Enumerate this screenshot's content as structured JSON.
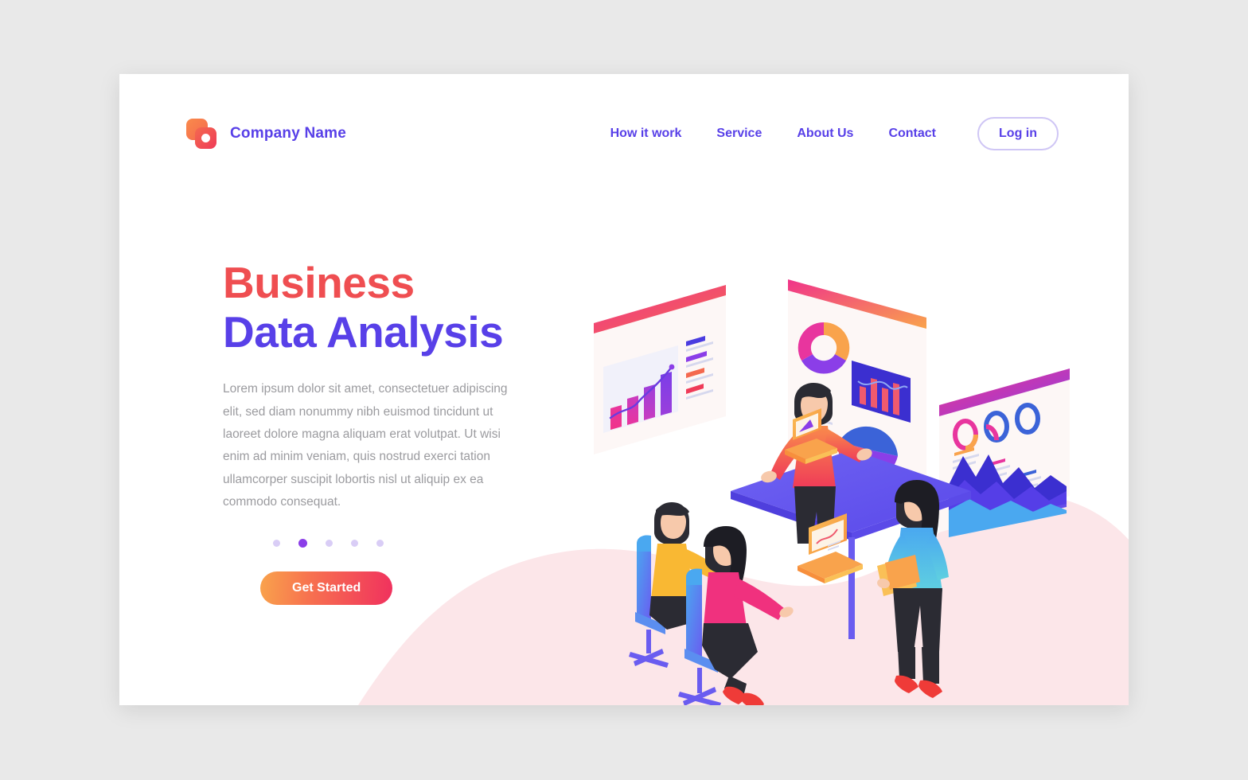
{
  "background_color": "#e9e9e9",
  "card_color": "#ffffff",
  "colors": {
    "primary_purple": "#5840e8",
    "accent_red": "#ef4e51",
    "accent_orange": "#f9a34c",
    "accent_pink": "#f0315e",
    "blob_pink": "#fce6e9",
    "muted_text": "#9b9b9f",
    "dot_inactive": "#d9cdf6",
    "dot_active": "#8b3ee8",
    "login_border": "#cfc6f5"
  },
  "header": {
    "brand_name": "Company Name",
    "logo_icon": "overlapping-squares-icon",
    "nav_items": [
      {
        "label": "How it work",
        "name": "nav-link-how-it-work"
      },
      {
        "label": "Service",
        "name": "nav-link-service"
      },
      {
        "label": "About Us",
        "name": "nav-link-about-us"
      },
      {
        "label": "Contact",
        "name": "nav-link-contact"
      }
    ],
    "login_label": "Log in"
  },
  "hero": {
    "title_line_1": "Business",
    "title_line_2": "Data Analysis",
    "paragraph": "Lorem ipsum dolor sit amet, consectetuer adipiscing elit, sed diam nonummy nibh euismod tincidunt ut laoreet dolore magna aliquam erat volutpat. Ut wisi enim ad minim veniam, quis nostrud exerci tation ullamcorper suscipit lobortis nisl ut aliquip ex ea commodo consequat.",
    "cta_label": "Get Started",
    "carousel": {
      "total_dots": 5,
      "active_index": 1
    }
  },
  "illustration": {
    "name": "isometric-business-data-analysis-illustration",
    "description": "Isometric scene: a presenter standing in front of three floating dashboard screens, two colleagues seated at a purple desk with laptops, and a standing woman holding a folder.",
    "screens": [
      {
        "name": "screen-left-bar-chart",
        "header_gradient": [
          "#f0338a",
          "#f4694f"
        ],
        "widgets": [
          "bar-chart",
          "trend-line",
          "list-rows"
        ],
        "bar_values": [
          38,
          55,
          72,
          92
        ],
        "bar_colors": [
          "#e8359e",
          "#d637a8",
          "#a93fd0",
          "#8b3ee8"
        ],
        "list_row_colors": [
          "#5840e8",
          "#8b3ee8",
          "#f4694f",
          "#ef3b58"
        ]
      },
      {
        "name": "screen-center-mixed",
        "header_gradient": [
          "#f0338a",
          "#f9a34c"
        ],
        "widgets": [
          "donut-chart",
          "list-rows",
          "bar-panel",
          "pie-chart"
        ],
        "donut_segments": [
          {
            "color": "#f9a34c",
            "pct": 34
          },
          {
            "color": "#8b3ee8",
            "pct": 33
          },
          {
            "color": "#e8359e",
            "pct": 33
          }
        ],
        "pie_segments": [
          {
            "color": "#f4694f",
            "pct": 45
          },
          {
            "color": "#3b63d8",
            "pct": 25
          },
          {
            "color": "#8b3ee8",
            "pct": 30
          }
        ],
        "panel_bar_values": [
          60,
          85,
          70,
          95,
          55
        ],
        "panel_background": "#3b2fd0"
      },
      {
        "name": "screen-right-area-chart",
        "header_gradient": [
          "#f0338a",
          "#8b3ee8"
        ],
        "widgets": [
          "ring-gauge",
          "ring-gauge",
          "ring-gauge",
          "area-chart"
        ],
        "ring_colors": [
          "#f9a34c",
          "#e8359e",
          "#3b63d8"
        ],
        "area_colors": [
          "#3b2fd0",
          "#5840e8",
          "#4aa8f0"
        ]
      }
    ],
    "figures": [
      {
        "name": "presenter-standing-man",
        "shirt": "#f4694f",
        "pants": "#2b2b33"
      },
      {
        "name": "seated-man-yellow-shirt",
        "shirt": "#f9b833",
        "pants": "#2b2b33"
      },
      {
        "name": "seated-woman-pink-top",
        "shirt": "#f0317e",
        "pants": "#2b2b33",
        "shoes": "#ef3b38"
      },
      {
        "name": "standing-woman-blue-top",
        "shirt": "#4aa8f0",
        "pants": "#2b2b33",
        "shoes": "#ef3b38",
        "holding": "orange-folder"
      }
    ],
    "furniture": {
      "desk_color": "#6a5cf0",
      "chair_color": "#4aa8f0",
      "laptop_color": "#f9b04c"
    }
  }
}
